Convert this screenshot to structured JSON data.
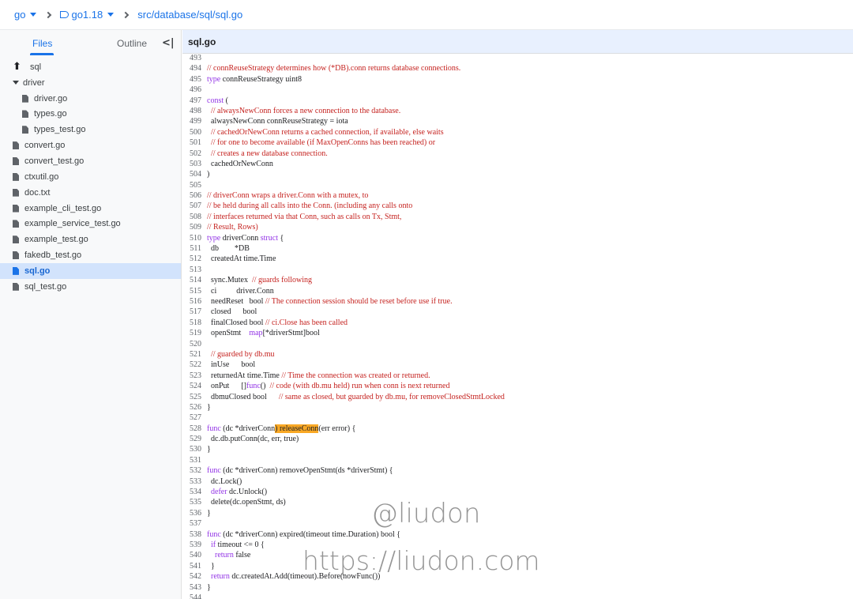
{
  "breadcrumb": {
    "repo": "go",
    "branch": "go1.18",
    "path": "src/database/sql/sql.go"
  },
  "sidebar": {
    "tab_files": "Files",
    "tab_outline": "Outline",
    "items": [
      {
        "label": "sql",
        "kind": "up"
      },
      {
        "label": "driver",
        "kind": "folder-open"
      },
      {
        "label": "driver.go",
        "kind": "file",
        "indent": 1
      },
      {
        "label": "types.go",
        "kind": "file",
        "indent": 1
      },
      {
        "label": "types_test.go",
        "kind": "file",
        "indent": 1
      },
      {
        "label": "convert.go",
        "kind": "file"
      },
      {
        "label": "convert_test.go",
        "kind": "file"
      },
      {
        "label": "ctxutil.go",
        "kind": "file"
      },
      {
        "label": "doc.txt",
        "kind": "file"
      },
      {
        "label": "example_cli_test.go",
        "kind": "file"
      },
      {
        "label": "example_service_test.go",
        "kind": "file"
      },
      {
        "label": "example_test.go",
        "kind": "file"
      },
      {
        "label": "fakedb_test.go",
        "kind": "file"
      },
      {
        "label": "sql.go",
        "kind": "file",
        "selected": true
      },
      {
        "label": "sql_test.go",
        "kind": "file"
      }
    ]
  },
  "editor": {
    "filename": "sql.go",
    "lines": [
      {
        "n": "493",
        "t": [
          {
            "s": ""
          }
        ]
      },
      {
        "n": "494",
        "t": [
          {
            "s": "// connReuseStrategy determines how (*DB).conn returns database connections.",
            "c": "comment"
          }
        ]
      },
      {
        "n": "495",
        "t": [
          {
            "s": "type",
            "c": "kw"
          },
          {
            "s": " connReuseStrategy uint8"
          }
        ]
      },
      {
        "n": "496",
        "t": [
          {
            "s": ""
          }
        ]
      },
      {
        "n": "497",
        "t": [
          {
            "s": "const",
            "c": "kw"
          },
          {
            "s": " ("
          }
        ]
      },
      {
        "n": "498",
        "t": [
          {
            "s": "  "
          },
          {
            "s": "// alwaysNewConn forces a new connection to the database.",
            "c": "comment"
          }
        ]
      },
      {
        "n": "499",
        "t": [
          {
            "s": "  alwaysNewConn connReuseStrategy = iota"
          }
        ]
      },
      {
        "n": "500",
        "t": [
          {
            "s": "  "
          },
          {
            "s": "// cachedOrNewConn returns a cached connection, if available, else waits",
            "c": "comment"
          }
        ]
      },
      {
        "n": "501",
        "t": [
          {
            "s": "  "
          },
          {
            "s": "// for one to become available (if MaxOpenConns has been reached) or",
            "c": "comment"
          }
        ]
      },
      {
        "n": "502",
        "t": [
          {
            "s": "  "
          },
          {
            "s": "// creates a new database connection.",
            "c": "comment"
          }
        ]
      },
      {
        "n": "503",
        "t": [
          {
            "s": "  cachedOrNewConn"
          }
        ]
      },
      {
        "n": "504",
        "t": [
          {
            "s": ")"
          }
        ]
      },
      {
        "n": "505",
        "t": [
          {
            "s": ""
          }
        ]
      },
      {
        "n": "506",
        "t": [
          {
            "s": "// driverConn wraps a driver.Conn with a mutex, to",
            "c": "comment"
          }
        ]
      },
      {
        "n": "507",
        "t": [
          {
            "s": "// be held during all calls into the Conn. (including any calls onto",
            "c": "comment"
          }
        ]
      },
      {
        "n": "508",
        "t": [
          {
            "s": "// interfaces returned via that Conn, such as calls on Tx, Stmt,",
            "c": "comment"
          }
        ]
      },
      {
        "n": "509",
        "t": [
          {
            "s": "// Result, Rows)",
            "c": "comment"
          }
        ]
      },
      {
        "n": "510",
        "t": [
          {
            "s": "type",
            "c": "kw"
          },
          {
            "s": " driverConn "
          },
          {
            "s": "struct",
            "c": "kw"
          },
          {
            "s": " {"
          }
        ]
      },
      {
        "n": "511",
        "t": [
          {
            "s": "  db        *DB"
          }
        ]
      },
      {
        "n": "512",
        "t": [
          {
            "s": "  createdAt time.Time"
          }
        ]
      },
      {
        "n": "513",
        "t": [
          {
            "s": ""
          }
        ]
      },
      {
        "n": "514",
        "t": [
          {
            "s": "  sync.Mutex  "
          },
          {
            "s": "// guards following",
            "c": "comment"
          }
        ]
      },
      {
        "n": "515",
        "t": [
          {
            "s": "  ci          driver.Conn"
          }
        ]
      },
      {
        "n": "516",
        "t": [
          {
            "s": "  needReset   bool "
          },
          {
            "s": "// The connection session should be reset before use if true.",
            "c": "comment"
          }
        ]
      },
      {
        "n": "517",
        "t": [
          {
            "s": "  closed      bool"
          }
        ]
      },
      {
        "n": "518",
        "t": [
          {
            "s": "  finalClosed bool "
          },
          {
            "s": "// ci.Close has been called",
            "c": "comment"
          }
        ]
      },
      {
        "n": "519",
        "t": [
          {
            "s": "  openStmt    "
          },
          {
            "s": "map",
            "c": "kw"
          },
          {
            "s": "[*driverStmt]bool"
          }
        ]
      },
      {
        "n": "520",
        "t": [
          {
            "s": ""
          }
        ]
      },
      {
        "n": "521",
        "t": [
          {
            "s": "  "
          },
          {
            "s": "// guarded by db.mu",
            "c": "comment"
          }
        ]
      },
      {
        "n": "522",
        "t": [
          {
            "s": "  inUse      bool"
          }
        ]
      },
      {
        "n": "523",
        "t": [
          {
            "s": "  returnedAt time.Time "
          },
          {
            "s": "// Time the connection was created or returned.",
            "c": "comment"
          }
        ]
      },
      {
        "n": "524",
        "t": [
          {
            "s": "  onPut      []"
          },
          {
            "s": "func",
            "c": "kw"
          },
          {
            "s": "()  "
          },
          {
            "s": "// code (with db.mu held) run when conn is next returned",
            "c": "comment"
          }
        ]
      },
      {
        "n": "525",
        "t": [
          {
            "s": "  dbmuClosed bool      "
          },
          {
            "s": "// same as closed, but guarded by db.mu, for removeClosedStmtLocked",
            "c": "comment"
          }
        ]
      },
      {
        "n": "526",
        "t": [
          {
            "s": "}"
          }
        ]
      },
      {
        "n": "527",
        "t": [
          {
            "s": ""
          }
        ]
      },
      {
        "n": "528",
        "t": [
          {
            "s": "func",
            "c": "kw"
          },
          {
            "s": " (dc *driverConn"
          },
          {
            "s": ") releaseConn",
            "c": "hl"
          },
          {
            "s": "(err error) {"
          }
        ]
      },
      {
        "n": "529",
        "t": [
          {
            "s": "  dc.db.putConn(dc, err, true)"
          }
        ]
      },
      {
        "n": "530",
        "t": [
          {
            "s": "}"
          }
        ]
      },
      {
        "n": "531",
        "t": [
          {
            "s": ""
          }
        ]
      },
      {
        "n": "532",
        "t": [
          {
            "s": "func",
            "c": "kw"
          },
          {
            "s": " (dc *driverConn) removeOpenStmt(ds *driverStmt) {"
          }
        ]
      },
      {
        "n": "533",
        "t": [
          {
            "s": "  dc.Lock()"
          }
        ]
      },
      {
        "n": "534",
        "t": [
          {
            "s": "  "
          },
          {
            "s": "defer",
            "c": "kw"
          },
          {
            "s": " dc.Unlock()"
          }
        ]
      },
      {
        "n": "535",
        "t": [
          {
            "s": "  delete(dc.openStmt, ds)"
          }
        ]
      },
      {
        "n": "536",
        "t": [
          {
            "s": "}"
          }
        ]
      },
      {
        "n": "537",
        "t": [
          {
            "s": ""
          }
        ]
      },
      {
        "n": "538",
        "t": [
          {
            "s": "func",
            "c": "kw"
          },
          {
            "s": " (dc *driverConn) expired(timeout time.Duration) bool {"
          }
        ]
      },
      {
        "n": "539",
        "t": [
          {
            "s": "  "
          },
          {
            "s": "if",
            "c": "kw"
          },
          {
            "s": " timeout <= 0 {"
          }
        ]
      },
      {
        "n": "540",
        "t": [
          {
            "s": "    "
          },
          {
            "s": "return",
            "c": "kw"
          },
          {
            "s": " false"
          }
        ]
      },
      {
        "n": "541",
        "t": [
          {
            "s": "  }"
          }
        ]
      },
      {
        "n": "542",
        "t": [
          {
            "s": "  "
          },
          {
            "s": "return",
            "c": "kw"
          },
          {
            "s": " dc.createdAt.Add(timeout).Before(nowFunc())"
          }
        ]
      },
      {
        "n": "543",
        "t": [
          {
            "s": "}"
          }
        ]
      },
      {
        "n": "544",
        "t": [
          {
            "s": ""
          }
        ]
      }
    ]
  },
  "watermark": {
    "handle": "@liudon",
    "url": "https://liudon.com"
  },
  "colors": {
    "accent": "#1a73e8",
    "comment": "#c5221f",
    "keyword": "#9334e6",
    "highlight": "#f9a825"
  }
}
